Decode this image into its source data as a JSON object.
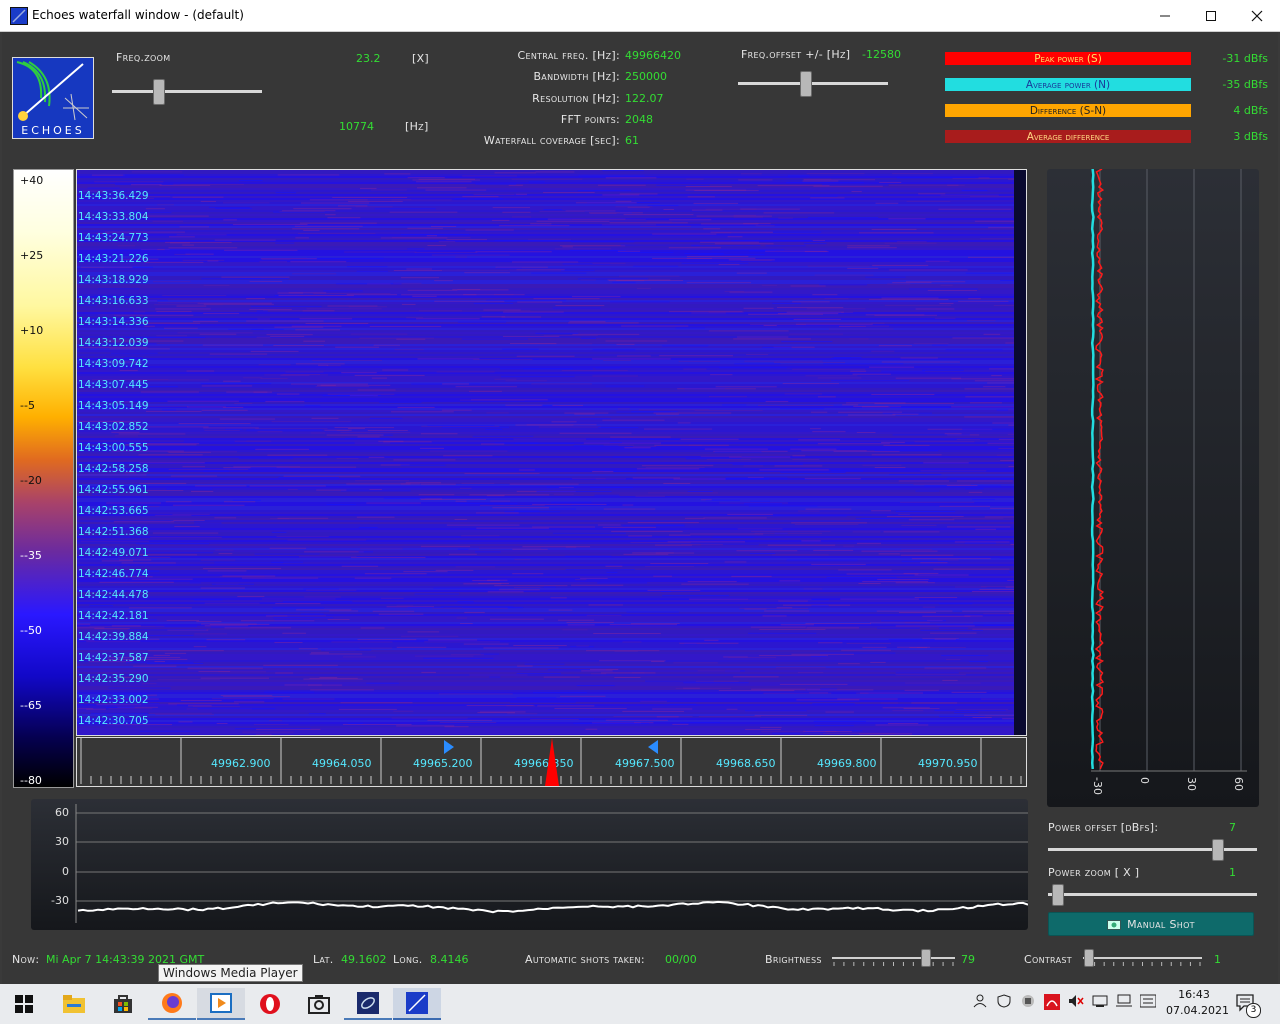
{
  "window": {
    "title": "Echoes waterfall window - (default)"
  },
  "header": {
    "logo_text": "ECHOES",
    "freq_zoom": {
      "label": "Freq.zoom",
      "value": "23.2",
      "unit": "[X]",
      "value2": "10774",
      "unit2": "[Hz]",
      "level": 0.3
    },
    "central_freq": {
      "label": "Central freq. [Hz]:",
      "value": "49966420"
    },
    "bandwidth": {
      "label": "Bandwidth [Hz]:",
      "value": "250000"
    },
    "resolution": {
      "label": "Resolution [Hz]:",
      "value": "122.07"
    },
    "fft_points": {
      "label": "FFT points:",
      "value": "2048"
    },
    "waterfall_coverage": {
      "label": "Waterfall coverage [sec]:",
      "value": "61"
    },
    "freq_offset": {
      "label": "Freq.offset +/- [Hz]",
      "value": "-12580",
      "level": 0.45
    },
    "legend": [
      {
        "label": "Peak power (S)",
        "value": "-31 dBfs",
        "color": "#ff0000",
        "text_color": "#ffe066"
      },
      {
        "label": "Average power (N)",
        "value": "-35 dBfs",
        "color": "#22dde0",
        "text_color": "#1a3a9a"
      },
      {
        "label": "Difference (S-N)",
        "value": "4 dBfs",
        "color": "#ffa500",
        "text_color": "#222222"
      },
      {
        "label": "Average difference",
        "value": "3 dBfs",
        "color": "#a81c1c",
        "text_color": "#ffd580"
      }
    ]
  },
  "colorbar": {
    "labels": [
      "+40",
      "+25",
      "+10",
      "--5",
      "--20",
      "--35",
      "--50",
      "--65",
      "--80"
    ]
  },
  "waterfall": {
    "timestamps": [
      "14:43:36.429",
      "14:43:33.804",
      "14:43:24.773",
      "14:43:21.226",
      "14:43:18.929",
      "14:43:16.633",
      "14:43:14.336",
      "14:43:12.039",
      "14:43:09.742",
      "14:43:07.445",
      "14:43:05.149",
      "14:43:02.852",
      "14:43:00.555",
      "14:42:58.258",
      "14:42:55.961",
      "14:42:53.665",
      "14:42:51.368",
      "14:42:49.071",
      "14:42:46.774",
      "14:42:44.478",
      "14:42:42.181",
      "14:42:39.884",
      "14:42:37.587",
      "14:42:35.290",
      "14:42:33.002",
      "14:42:30.705"
    ]
  },
  "freq_axis": {
    "ticks": [
      "49962.900",
      "49964.050",
      "49965.200",
      "49966.350",
      "49967.500",
      "49968.650",
      "49969.800",
      "49970.950"
    ]
  },
  "power_panel": {
    "tick_labels": [
      "-30",
      "0",
      "30",
      "60"
    ],
    "power_offset": {
      "label": "Power offset [dBfs]:",
      "value": "7",
      "level": 0.83
    },
    "power_zoom": {
      "label": "Power zoom [ X ]",
      "value": "1",
      "level": 0.02
    },
    "manual_shot": "Manual Shot"
  },
  "bottom_chart": {
    "y_ticks": [
      "60",
      "30",
      "0",
      "-30"
    ]
  },
  "status": {
    "now_label": "Now:",
    "now_value": "Mi Apr 7 14:43:39 2021 GMT",
    "lat_label": "Lat.",
    "lat_value": "49.1602",
    "long_label": "Long.",
    "long_value": "8.4146",
    "shots_label": "Automatic shots taken:",
    "shots_value": "00/00",
    "brightness_label": "Brightness",
    "brightness_value": "79",
    "brightness_level": 0.79,
    "contrast_label": "Contrast",
    "contrast_value": "1",
    "contrast_level": 0.01
  },
  "tooltip": "Windows Media Player",
  "taskbar": {
    "icons": [
      "windows-start-icon",
      "file-explorer-icon",
      "store-icon",
      "firefox-icon",
      "media-player-icon",
      "opera-icon",
      "camera-app-icon",
      "satellite-app-icon",
      "echoes-app-icon"
    ],
    "time": "16:43",
    "date": "07.04.2021",
    "notifications": "3"
  }
}
